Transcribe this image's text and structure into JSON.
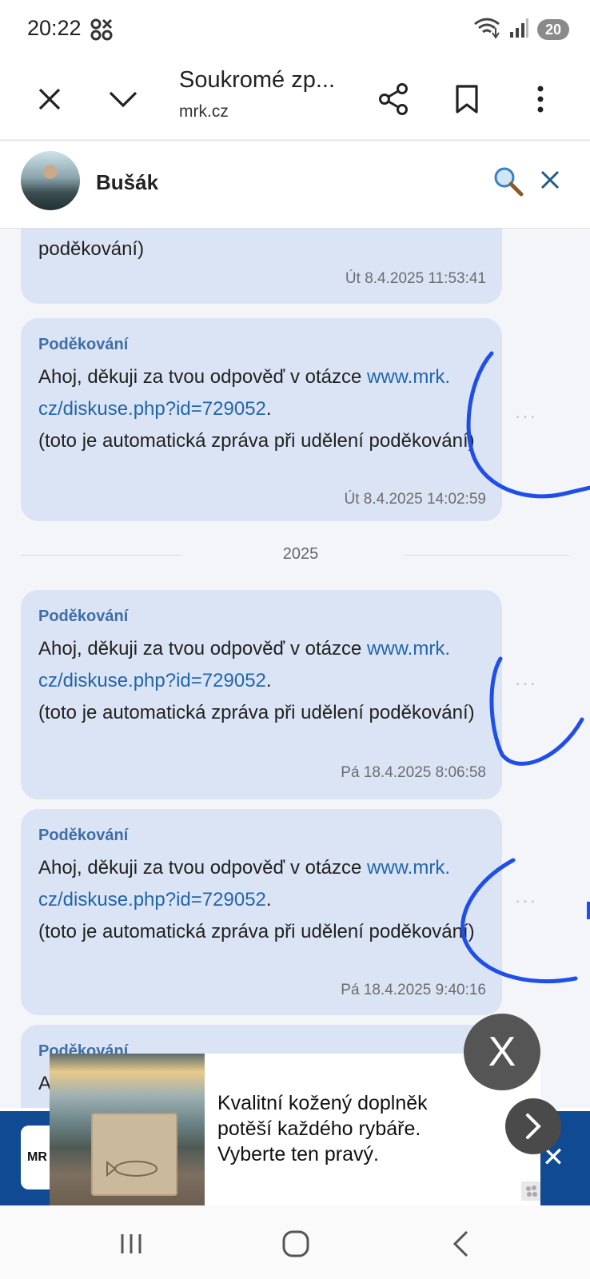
{
  "status_bar": {
    "time": "20:22",
    "battery": "20",
    "icons": [
      "app-grid-icon",
      "wifi-icon",
      "signal-icon",
      "battery-icon"
    ]
  },
  "toolbar": {
    "title": "Soukromé zp...",
    "domain": "mrk.cz",
    "icons": [
      "close-icon",
      "chevron-down-icon",
      "share-icon",
      "bookmark-icon",
      "more-vert-icon"
    ]
  },
  "chat_header": {
    "contact_name": "Bušák",
    "icons": [
      "search-icon",
      "close-icon"
    ]
  },
  "messages": [
    {
      "title": "",
      "body_visible": "poděkování)",
      "time": "Út 8.4.2025 11:53:41"
    },
    {
      "title": "Poděkování",
      "text_before": "Ahoj, děkuji za tvou odpověď v otázce ",
      "link": "www.mrk.cz/diskuse.php?id=729052",
      "link_line1": "www.mrk.",
      "link_line2": "cz/diskuse.php?id=729052",
      "text_after": ".",
      "note": "(toto je automatická zpráva při udělení poděkování)",
      "time": "Út 8.4.2025 14:02:59",
      "more": "···"
    },
    {
      "title": "Poděkování",
      "text_before": "Ahoj, děkuji za tvou odpověď v otázce ",
      "link": "www.mrk.cz/diskuse.php?id=729052",
      "link_line1": "www.mrk.",
      "link_line2": "cz/diskuse.php?id=729052",
      "text_after": ".",
      "note": "(toto je automatická zpráva při udělení poděkování)",
      "time": "Pá 18.4.2025 8:06:58",
      "more": "···"
    },
    {
      "title": "Poděkování",
      "text_before": "Ahoj, děkuji za tvou odpověď v otázce ",
      "link": "www.mrk.cz/diskuse.php?id=729052",
      "link_line1": "www.mrk.",
      "link_line2": "cz/diskuse.php?id=729052",
      "text_after": ".",
      "note": "(toto je automatická zpráva při udělení poděkování)",
      "time": "Pá 18.4.2025 9:40:16",
      "more": "···"
    },
    {
      "title": "Poděkování",
      "body_visible": "A"
    }
  ],
  "year_divider": "2025",
  "ad": {
    "text": "Kvalitní kožený doplněk potěší každého rybáře. Vyberte ten pravý.",
    "logo_text": "MR",
    "close_label": "X",
    "banner_close": "✕",
    "info_icon": "ad-info-icon"
  },
  "nav_bar": {
    "icons": [
      "recent-apps-icon",
      "home-icon",
      "back-icon"
    ]
  },
  "colors": {
    "bubble": "#dbe4f5",
    "link": "#2366a8",
    "title": "#3f6ea5",
    "ad_banner": "#0f4a93",
    "annotation": "#1f4fe6"
  }
}
